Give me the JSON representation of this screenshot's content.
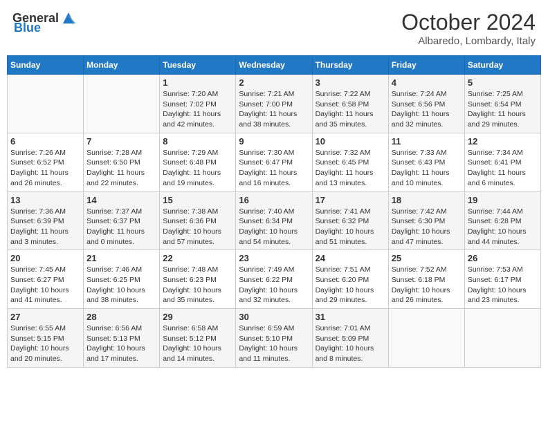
{
  "header": {
    "logo_general": "General",
    "logo_blue": "Blue",
    "month_title": "October 2024",
    "location": "Albaredo, Lombardy, Italy"
  },
  "calendar": {
    "days_of_week": [
      "Sunday",
      "Monday",
      "Tuesday",
      "Wednesday",
      "Thursday",
      "Friday",
      "Saturday"
    ],
    "weeks": [
      [
        {
          "day": "",
          "info": ""
        },
        {
          "day": "",
          "info": ""
        },
        {
          "day": "1",
          "info": "Sunrise: 7:20 AM\nSunset: 7:02 PM\nDaylight: 11 hours and 42 minutes."
        },
        {
          "day": "2",
          "info": "Sunrise: 7:21 AM\nSunset: 7:00 PM\nDaylight: 11 hours and 38 minutes."
        },
        {
          "day": "3",
          "info": "Sunrise: 7:22 AM\nSunset: 6:58 PM\nDaylight: 11 hours and 35 minutes."
        },
        {
          "day": "4",
          "info": "Sunrise: 7:24 AM\nSunset: 6:56 PM\nDaylight: 11 hours and 32 minutes."
        },
        {
          "day": "5",
          "info": "Sunrise: 7:25 AM\nSunset: 6:54 PM\nDaylight: 11 hours and 29 minutes."
        }
      ],
      [
        {
          "day": "6",
          "info": "Sunrise: 7:26 AM\nSunset: 6:52 PM\nDaylight: 11 hours and 26 minutes."
        },
        {
          "day": "7",
          "info": "Sunrise: 7:28 AM\nSunset: 6:50 PM\nDaylight: 11 hours and 22 minutes."
        },
        {
          "day": "8",
          "info": "Sunrise: 7:29 AM\nSunset: 6:48 PM\nDaylight: 11 hours and 19 minutes."
        },
        {
          "day": "9",
          "info": "Sunrise: 7:30 AM\nSunset: 6:47 PM\nDaylight: 11 hours and 16 minutes."
        },
        {
          "day": "10",
          "info": "Sunrise: 7:32 AM\nSunset: 6:45 PM\nDaylight: 11 hours and 13 minutes."
        },
        {
          "day": "11",
          "info": "Sunrise: 7:33 AM\nSunset: 6:43 PM\nDaylight: 11 hours and 10 minutes."
        },
        {
          "day": "12",
          "info": "Sunrise: 7:34 AM\nSunset: 6:41 PM\nDaylight: 11 hours and 6 minutes."
        }
      ],
      [
        {
          "day": "13",
          "info": "Sunrise: 7:36 AM\nSunset: 6:39 PM\nDaylight: 11 hours and 3 minutes."
        },
        {
          "day": "14",
          "info": "Sunrise: 7:37 AM\nSunset: 6:37 PM\nDaylight: 11 hours and 0 minutes."
        },
        {
          "day": "15",
          "info": "Sunrise: 7:38 AM\nSunset: 6:36 PM\nDaylight: 10 hours and 57 minutes."
        },
        {
          "day": "16",
          "info": "Sunrise: 7:40 AM\nSunset: 6:34 PM\nDaylight: 10 hours and 54 minutes."
        },
        {
          "day": "17",
          "info": "Sunrise: 7:41 AM\nSunset: 6:32 PM\nDaylight: 10 hours and 51 minutes."
        },
        {
          "day": "18",
          "info": "Sunrise: 7:42 AM\nSunset: 6:30 PM\nDaylight: 10 hours and 47 minutes."
        },
        {
          "day": "19",
          "info": "Sunrise: 7:44 AM\nSunset: 6:28 PM\nDaylight: 10 hours and 44 minutes."
        }
      ],
      [
        {
          "day": "20",
          "info": "Sunrise: 7:45 AM\nSunset: 6:27 PM\nDaylight: 10 hours and 41 minutes."
        },
        {
          "day": "21",
          "info": "Sunrise: 7:46 AM\nSunset: 6:25 PM\nDaylight: 10 hours and 38 minutes."
        },
        {
          "day": "22",
          "info": "Sunrise: 7:48 AM\nSunset: 6:23 PM\nDaylight: 10 hours and 35 minutes."
        },
        {
          "day": "23",
          "info": "Sunrise: 7:49 AM\nSunset: 6:22 PM\nDaylight: 10 hours and 32 minutes."
        },
        {
          "day": "24",
          "info": "Sunrise: 7:51 AM\nSunset: 6:20 PM\nDaylight: 10 hours and 29 minutes."
        },
        {
          "day": "25",
          "info": "Sunrise: 7:52 AM\nSunset: 6:18 PM\nDaylight: 10 hours and 26 minutes."
        },
        {
          "day": "26",
          "info": "Sunrise: 7:53 AM\nSunset: 6:17 PM\nDaylight: 10 hours and 23 minutes."
        }
      ],
      [
        {
          "day": "27",
          "info": "Sunrise: 6:55 AM\nSunset: 5:15 PM\nDaylight: 10 hours and 20 minutes."
        },
        {
          "day": "28",
          "info": "Sunrise: 6:56 AM\nSunset: 5:13 PM\nDaylight: 10 hours and 17 minutes."
        },
        {
          "day": "29",
          "info": "Sunrise: 6:58 AM\nSunset: 5:12 PM\nDaylight: 10 hours and 14 minutes."
        },
        {
          "day": "30",
          "info": "Sunrise: 6:59 AM\nSunset: 5:10 PM\nDaylight: 10 hours and 11 minutes."
        },
        {
          "day": "31",
          "info": "Sunrise: 7:01 AM\nSunset: 5:09 PM\nDaylight: 10 hours and 8 minutes."
        },
        {
          "day": "",
          "info": ""
        },
        {
          "day": "",
          "info": ""
        }
      ]
    ]
  }
}
